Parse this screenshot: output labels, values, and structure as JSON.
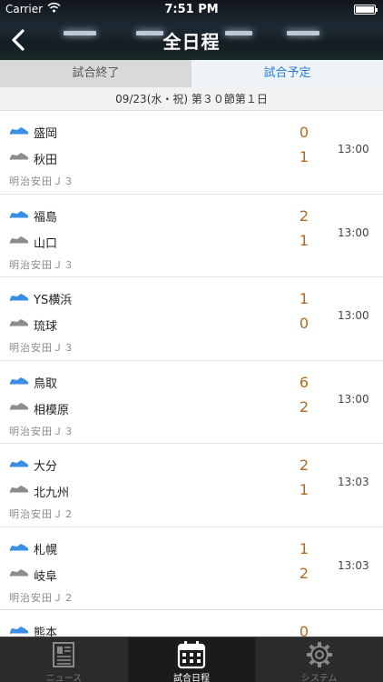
{
  "status_bar": {
    "carrier": "Carrier",
    "time": "7:51 PM"
  },
  "header": {
    "title": "全日程"
  },
  "segments": [
    {
      "label": "試合終了",
      "active": false
    },
    {
      "label": "試合予定",
      "active": true
    }
  ],
  "date_header": "09/23(水・祝) 第３０節第１日",
  "matches": [
    {
      "home": "盛岡",
      "away": "秋田",
      "home_score": "0",
      "away_score": "1",
      "time": "13:00",
      "league": "明治安田Ｊ３"
    },
    {
      "home": "福島",
      "away": "山口",
      "home_score": "2",
      "away_score": "1",
      "time": "13:00",
      "league": "明治安田Ｊ３"
    },
    {
      "home": "YS横浜",
      "away": "琉球",
      "home_score": "1",
      "away_score": "0",
      "time": "13:00",
      "league": "明治安田Ｊ３"
    },
    {
      "home": "鳥取",
      "away": "相模原",
      "home_score": "6",
      "away_score": "2",
      "time": "13:00",
      "league": "明治安田Ｊ３"
    },
    {
      "home": "大分",
      "away": "北九州",
      "home_score": "2",
      "away_score": "1",
      "time": "13:03",
      "league": "明治安田Ｊ２"
    },
    {
      "home": "札幌",
      "away": "岐阜",
      "home_score": "1",
      "away_score": "2",
      "time": "13:03",
      "league": "明治安田Ｊ２"
    },
    {
      "home": "熊本",
      "away": "",
      "home_score": "0",
      "away_score": "",
      "time": "",
      "league": ""
    }
  ],
  "tabs": [
    {
      "label": "ニュース",
      "icon": "news-icon",
      "active": false
    },
    {
      "label": "試合日程",
      "icon": "calendar-icon",
      "active": true
    },
    {
      "label": "システム",
      "icon": "gear-icon",
      "active": false
    }
  ],
  "colors": {
    "accent": "#2a7dd6",
    "score": "#b46a1e",
    "home_shoe": "#3a8ee6",
    "away_shoe": "#8c8c8c"
  }
}
